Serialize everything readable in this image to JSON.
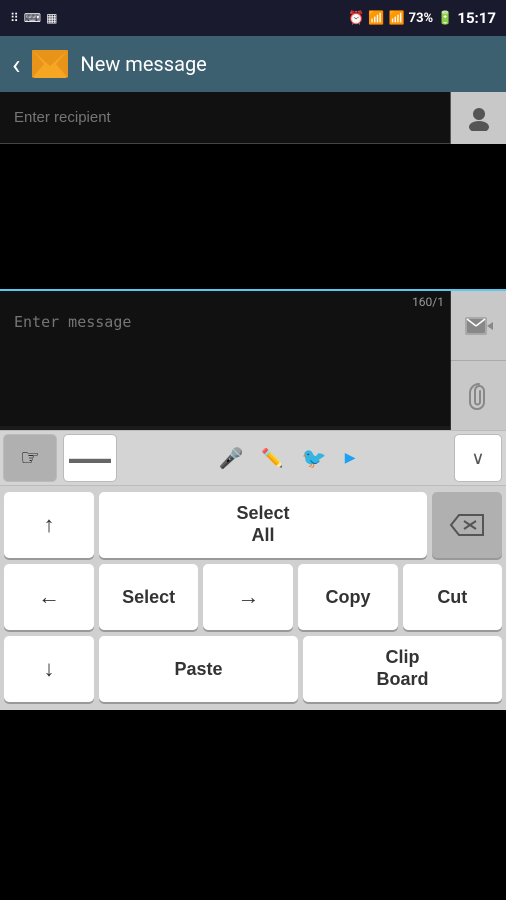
{
  "statusBar": {
    "leftIcons": [
      "⠿",
      "⌨",
      "🖼"
    ],
    "time": "15:17",
    "battery": "73%",
    "signal": "▲"
  },
  "header": {
    "backLabel": "‹",
    "title": "New message"
  },
  "recipient": {
    "placeholder": "Enter recipient",
    "value": ""
  },
  "messageArea": {
    "counter": "160/1",
    "placeholder": "Enter message"
  },
  "keyboardToolbar": {
    "btn1": "☞",
    "micIcon": "🎤",
    "pencilIcon": "✏",
    "twitterIcon": "🐦",
    "chevronIcon": "∨"
  },
  "keyboard": {
    "row1": {
      "upArrow": "↑",
      "selectAll": "Select\nAll",
      "deleteIcon": "⌫"
    },
    "row2": {
      "leftArrow": "←",
      "select": "Select",
      "rightArrow": "→",
      "copy": "Copy",
      "cut": "Cut"
    },
    "row3": {
      "downArrow": "↓",
      "paste": "Paste",
      "clipboard": "Clip\nBoard"
    }
  }
}
